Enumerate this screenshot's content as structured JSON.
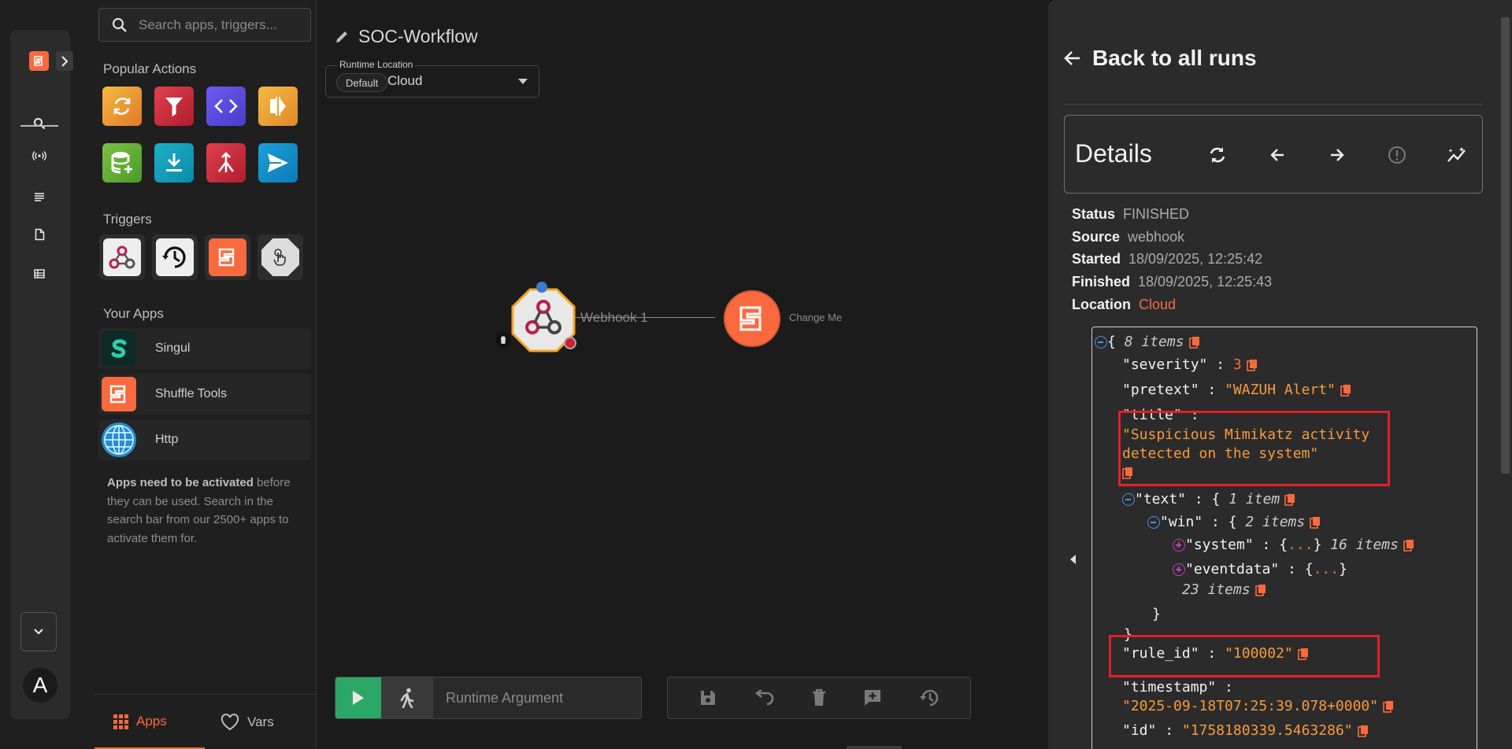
{
  "sidebar": {
    "search_placeholder": "Search apps, triggers...",
    "popular_title": "Popular Actions",
    "triggers_title": "Triggers",
    "your_apps_title": "Your Apps",
    "apps": [
      "Singul",
      "Shuffle Tools",
      "Http"
    ],
    "note_bold": "Apps need to be activated",
    "note_rest": " before they can be used. Search in the search bar from our 2500+ apps to activate them for.",
    "tabs": {
      "apps": "Apps",
      "vars": "Vars"
    }
  },
  "rail": {
    "avatar_letter": "A"
  },
  "workflow": {
    "title": "SOC-Workflow",
    "runtime_label": "Runtime Location",
    "runtime_chip": "Default",
    "runtime_value": "Cloud",
    "nodes": [
      "Webhook 1",
      "Change Me"
    ],
    "runtime_argument_placeholder": "Runtime Argument"
  },
  "panel": {
    "back_label": "Back to all runs",
    "details_title": "Details",
    "meta": {
      "status_label": "Status",
      "status": "FINISHED",
      "source_label": "Source",
      "source": "webhook",
      "started_label": "Started",
      "started": "18/09/2025, 12:25:42",
      "finished_label": "Finished",
      "finished": "18/09/2025, 12:25:43",
      "location_label": "Location",
      "location": "Cloud"
    },
    "json": {
      "root_count": "8 items",
      "severity_key": "\"severity\"",
      "severity": "3",
      "pretext_key": "\"pretext\"",
      "pretext": "\"WAZUH Alert\"",
      "title_key": "\"title\"",
      "title_line1": "\"Suspicious Mimikatz activity",
      "title_line2": "detected on the system\"",
      "text_key": "\"text\"",
      "text_count": "1 item",
      "win_key": "\"win\"",
      "win_count": "2 items",
      "system_key": "\"system\"",
      "system_count": "16 items",
      "eventdata_key": "\"eventdata\"",
      "eventdata_count": "23 items",
      "rule_id_key": "\"rule_id\"",
      "rule_id": "\"100002\"",
      "timestamp_key": "\"timestamp\"",
      "timestamp": "\"2025-09-18T07:25:39.078+0000\"",
      "id_key": "\"id\"",
      "id": "\"1758180339.5463286\""
    }
  },
  "colors": {
    "accent": "#f86a3e",
    "highlight": "#e0202a",
    "success": "#2ba866"
  }
}
